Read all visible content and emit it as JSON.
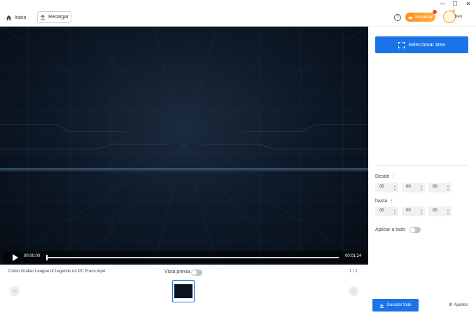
{
  "window": {
    "minimize_glyph": "—",
    "maximize_glyph": "☐",
    "close_glyph": "✕"
  },
  "toolbar": {
    "home_label": "Inicio",
    "home_icon": "home-icon",
    "reload_label": "Recargar",
    "reload_icon": "upload-icon",
    "help_glyph": "?",
    "upgrade_label": "Actualizar",
    "user_name": "ben"
  },
  "player": {
    "current_time": "00:00:00",
    "end_time": "00:01:24",
    "progress": 0
  },
  "strip": {
    "filename": "Como Grabar League of Legends no PC Fraco.mp4",
    "preview_label": "Vista previa",
    "preview_on": false,
    "page_info": "1 / 1",
    "prev_glyph": "‹",
    "next_glyph": "›"
  },
  "panel": {
    "select_area_label": "Seleccionar área",
    "from_label": "Desde",
    "to_label": "hasta",
    "info_glyph": "⋮",
    "from": [
      "00",
      "00",
      "00"
    ],
    "to": [
      "00",
      "00",
      "00"
    ],
    "apply_all_label": "Aplicar a todo",
    "apply_all_on": false,
    "save_all_label": "Guardar todo",
    "settings_label": "Ajustes"
  },
  "colors": {
    "accent": "#1a73e8",
    "upgrade": "#ff8a1e"
  }
}
